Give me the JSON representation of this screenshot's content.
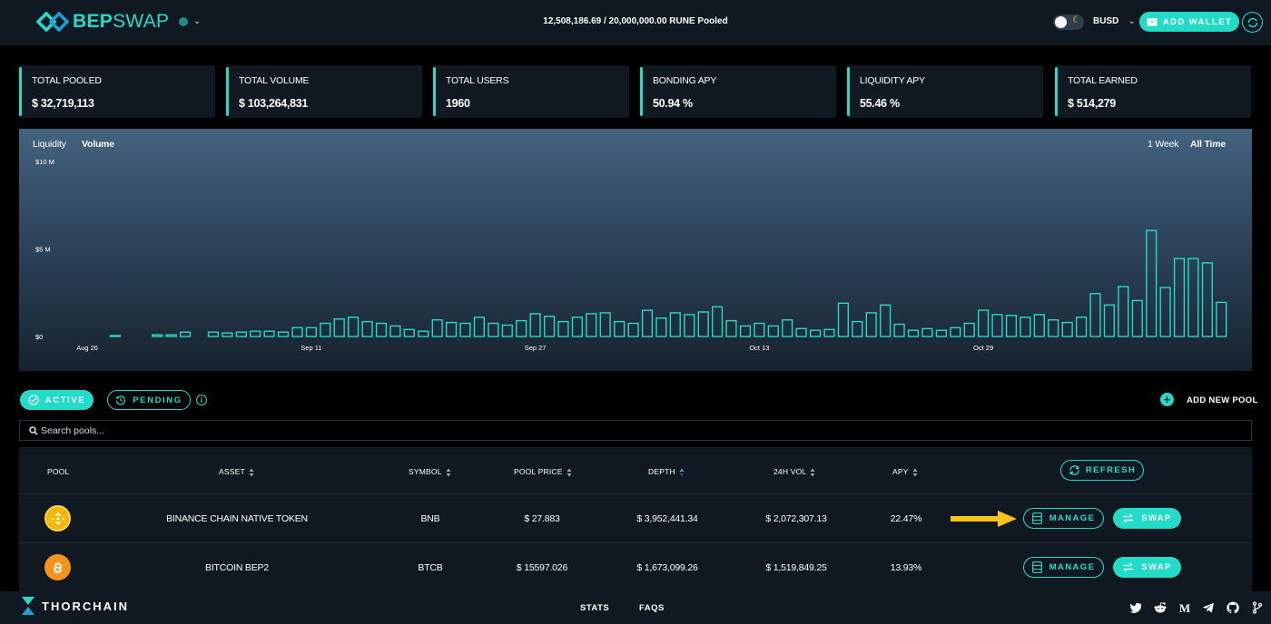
{
  "header": {
    "logo_bold": "BEP",
    "logo_light": "SWAP",
    "pooled_text": "12,508,186.69 / 20,000,000.00 RUNE Pooled",
    "currency": "BUSD",
    "add_wallet_label": "ADD WALLET",
    "network_status_color": "#1c8f82"
  },
  "stats": [
    {
      "label": "TOTAL POOLED",
      "value": "$ 32,719,113"
    },
    {
      "label": "TOTAL VOLUME",
      "value": "$ 103,264,831"
    },
    {
      "label": "TOTAL USERS",
      "value": "1960"
    },
    {
      "label": "BONDING APY",
      "value": "50.94 %"
    },
    {
      "label": "LIQUIDITY APY",
      "value": "55.46 %"
    },
    {
      "label": "TOTAL EARNED",
      "value": "$ 514,279"
    }
  ],
  "chart": {
    "tabs": [
      "Liquidity",
      "Volume"
    ],
    "active_tab": "Volume",
    "ranges": [
      "1 Week",
      "All Time"
    ],
    "active_range": "All Time"
  },
  "chart_data": {
    "type": "bar",
    "y_ticks": [
      "$10 M",
      "$5 M",
      "$0"
    ],
    "ylim": [
      0,
      10
    ],
    "x_ticks": [
      "Aug 26",
      "Sep 11",
      "Sep 27",
      "Oct 13",
      "Oct 29"
    ],
    "unit": "M",
    "series": [
      {
        "values": [
          0,
          0,
          0,
          0.05,
          0,
          0,
          0.1,
          0.1,
          0.25,
          0,
          0.25,
          0.2,
          0.25,
          0.3,
          0.3,
          0.25,
          0.5,
          0.5,
          0.75,
          1.0,
          1.1,
          0.85,
          0.75,
          0.6,
          0.4,
          0.3,
          0.95,
          0.8,
          0.75,
          1.1,
          0.75,
          0.65,
          0.9,
          1.3,
          1.15,
          0.85,
          1.1,
          1.3,
          1.35,
          0.85,
          0.75,
          1.5,
          1.05,
          1.35,
          1.25,
          1.4,
          1.7,
          0.9,
          0.6,
          0.75,
          0.6,
          0.95,
          0.45,
          0.35,
          0.4,
          1.9,
          0.85,
          1.35,
          1.8,
          0.7,
          0.35,
          0.45,
          0.35,
          0.5,
          0.75,
          1.5,
          1.25,
          1.2,
          1.1,
          1.25,
          0.95,
          0.8,
          1.1,
          2.45,
          1.8,
          2.85,
          2.05,
          6.05,
          2.8,
          4.45,
          4.45,
          4.2,
          1.95
        ]
      }
    ]
  },
  "filters": {
    "active_label": "ACTIVE",
    "pending_label": "PENDING",
    "add_pool_label": "ADD NEW POOL",
    "search_placeholder": "Search pools..."
  },
  "table": {
    "columns": [
      "POOL",
      "ASSET",
      "SYMBOL",
      "POOL PRICE",
      "DEPTH",
      "24H VOL",
      "APY"
    ],
    "refresh_label": "REFRESH",
    "manage_label": "MANAGE",
    "swap_label": "SWAP",
    "rows": [
      {
        "icon": "bnb-icon",
        "asset": "BINANCE CHAIN NATIVE TOKEN",
        "symbol": "BNB",
        "price": "$ 27.883",
        "depth": "$ 3,952,441.34",
        "vol": "$ 2,072,307.13",
        "apy": "22.47%"
      },
      {
        "icon": "btc-icon",
        "asset": "BITCOIN BEP2",
        "symbol": "BTCB",
        "price": "$ 15597.026",
        "depth": "$ 1,673,099.26",
        "vol": "$ 1,519,849.25",
        "apy": "13.93%"
      }
    ]
  },
  "footer": {
    "brand": "THORCHAIN",
    "links": [
      "STATS",
      "FAQS"
    ],
    "social": [
      "twitter-icon",
      "reddit-icon",
      "medium-icon",
      "telegram-icon",
      "github-icon",
      "git-branch-icon"
    ]
  },
  "colors": {
    "accent": "#23dcc8",
    "panel": "#101921",
    "background": "#000000",
    "arrow": "#f5c518"
  }
}
